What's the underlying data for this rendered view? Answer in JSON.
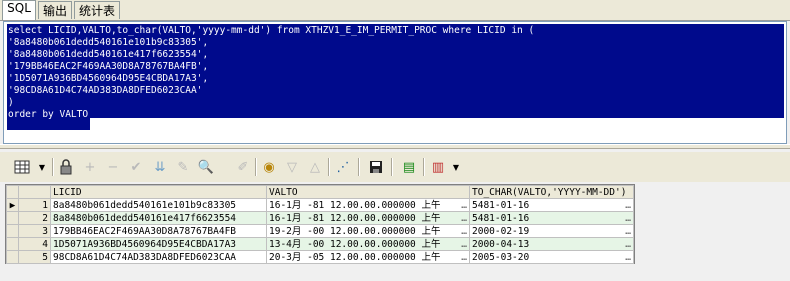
{
  "tabs": [
    {
      "label": "SQL",
      "active": true
    },
    {
      "label": "输出",
      "active": false
    },
    {
      "label": "统计表",
      "active": false
    }
  ],
  "editor": {
    "lines": [
      "select LICID,VALTO,to_char(VALTO,'yyyy-mm-dd') from XTHZV1_E_IM_PERMIT_PROC where LICID in (",
      "'8a8480b061dedd540161e101b9c83305',",
      "'8a8480b061dedd540161e417f6623554',",
      "'179BB46EAC2F469AA30D8A78767BA4FB',",
      "'1D5071A936BD4560964D95E4CBDA17A3',",
      "'98CD8A61D4C74AD383DA8DFED6023CAA'",
      ")",
      "order by VALTO"
    ],
    "selection_color": "#000a8c"
  },
  "toolbar": {
    "icons": [
      "grid-icon",
      "lock-icon",
      "add-record-icon",
      "delete-record-icon",
      "post-icon",
      "filter-icon",
      "edit-icon",
      "clear-icon",
      "query-icon",
      "next-icon",
      "previous-icon",
      "chart-icon",
      "save-icon",
      "print-icon",
      "export-icon"
    ]
  },
  "grid": {
    "columns": [
      "LICID",
      "VALTO",
      "TO_CHAR(VALTO,'YYYY-MM-DD')"
    ],
    "rows": [
      {
        "n": "1",
        "licid": "8a8480b061dedd540161e101b9c83305",
        "valto": "16-1月 -81 12.00.00.000000 上午",
        "tochar": "5481-01-16"
      },
      {
        "n": "2",
        "licid": "8a8480b061dedd540161e417f6623554",
        "valto": "16-1月 -81 12.00.00.000000 上午",
        "tochar": "5481-01-16"
      },
      {
        "n": "3",
        "licid": "179BB46EAC2F469AA30D8A78767BA4FB",
        "valto": "19-2月 -00 12.00.00.000000 上午",
        "tochar": "2000-02-19"
      },
      {
        "n": "4",
        "licid": "1D5071A936BD4560964D95E4CBDA17A3",
        "valto": "13-4月 -00 12.00.00.000000 上午",
        "tochar": "2000-04-13"
      },
      {
        "n": "5",
        "licid": "98CD8A61D4C74AD383DA8DFED6023CAA",
        "valto": "20-3月 -05 12.00.00.000000 上午",
        "tochar": "2005-03-20"
      }
    ],
    "ellipsis": "…"
  }
}
